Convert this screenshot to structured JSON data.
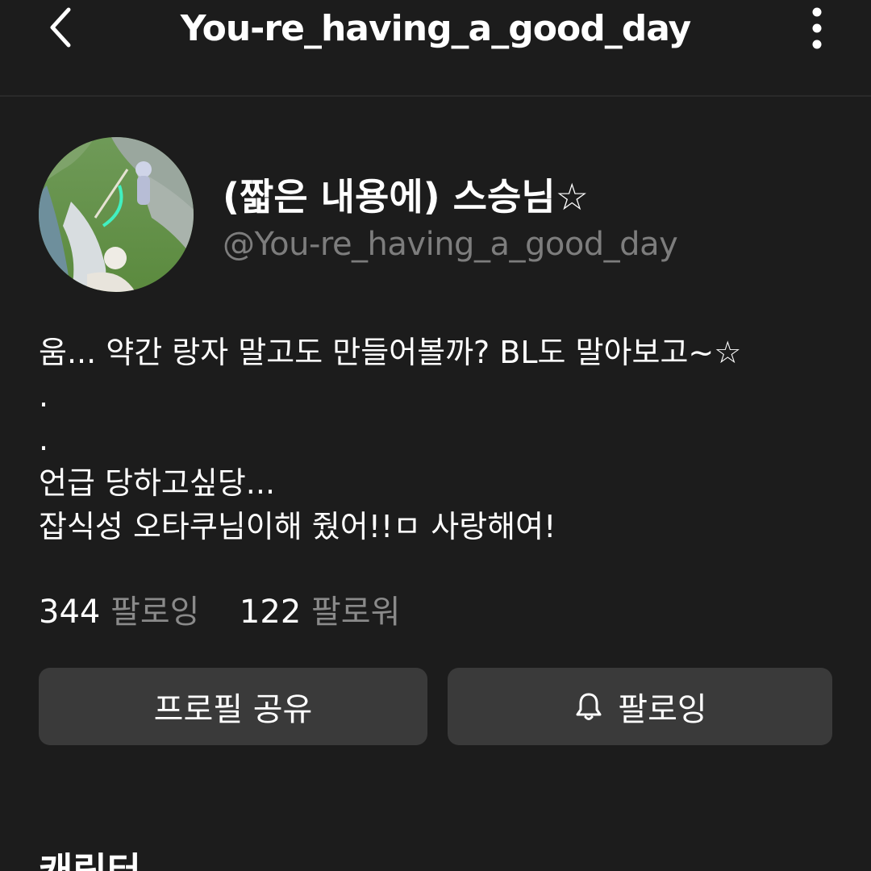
{
  "header": {
    "title": "You-re_having_a_good_day",
    "back_icon": "chevron-left-icon",
    "more_icon": "more-vertical-icon"
  },
  "profile": {
    "display_name": "(짧은 내용에) 스승님☆",
    "handle": "@You-re_having_a_good_day",
    "bio_lines": [
      "움... 약간 랑자 말고도 만들어볼까? BL도 말아보고~☆",
      ".",
      ".",
      "언급 당하고싶당...",
      "잡식성 오타쿠님이해 줬어!!ㅁ 사랑해여!"
    ]
  },
  "stats": {
    "following_count": "344",
    "following_label": "팔로잉",
    "followers_count": "122",
    "followers_label": "팔로워"
  },
  "actions": {
    "share_label": "프로필 공유",
    "follow_label": "팔로잉",
    "follow_icon": "bell-icon"
  },
  "section": {
    "heading": "캐릭터"
  },
  "colors": {
    "background": "#1c1c1c",
    "button_bg": "#3a3a3a",
    "muted_text": "#7d7d7d"
  }
}
